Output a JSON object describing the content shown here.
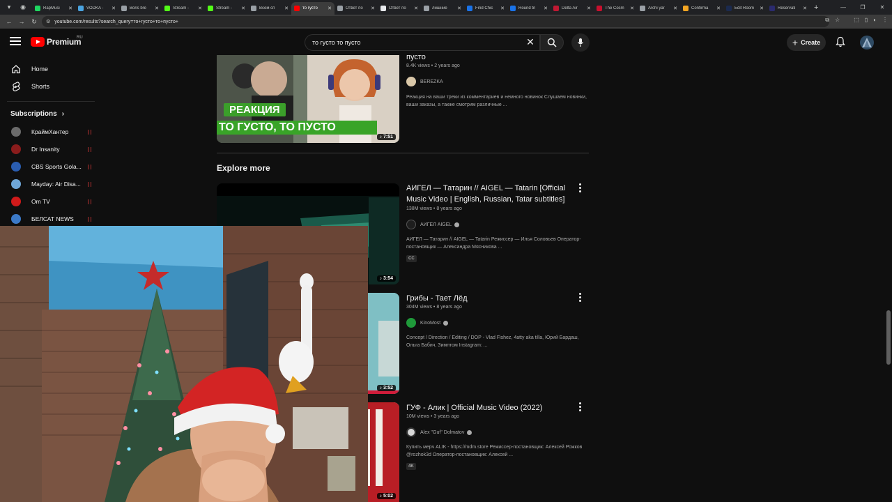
{
  "browser": {
    "tabs": [
      {
        "title": "RapMusi",
        "color": "#1ed760",
        "active": false
      },
      {
        "title": "VODKA -",
        "color": "#4aa3df",
        "active": false
      },
      {
        "title": "Boris bre",
        "color": "#9aa0a6",
        "active": false
      },
      {
        "title": "Stream - ",
        "color": "#53fc18",
        "active": false
      },
      {
        "title": "Stream - ",
        "color": "#53fc18",
        "active": false
      },
      {
        "title": "Всем сп",
        "color": "#9aa0a6",
        "active": false
      },
      {
        "title": "то густо",
        "color": "#ff0000",
        "active": true
      },
      {
        "title": "Ответ по",
        "color": "#9aa0a6",
        "active": false
      },
      {
        "title": "Ответ по",
        "color": "#e8eaed",
        "active": false
      },
      {
        "title": "лишние",
        "color": "#9aa0a6",
        "active": false
      },
      {
        "title": "Find Chic",
        "color": "#1a73e8",
        "active": false
      },
      {
        "title": "Round tri",
        "color": "#1a73e8",
        "active": false
      },
      {
        "title": "Delta Air",
        "color": "#c01933",
        "active": false
      },
      {
        "title": "The Cosm",
        "color": "#c8102e",
        "active": false
      },
      {
        "title": "Archi yar",
        "color": "#9aa0a6",
        "active": false
      },
      {
        "title": "Confirma",
        "color": "#f5a623",
        "active": false
      },
      {
        "title": "Edit Room",
        "color": "#1b2a4e",
        "active": false
      },
      {
        "title": "Reservati",
        "color": "#2b2b6e",
        "active": false
      }
    ],
    "url": "youtube.com/results?search_query=то+густо+то+пусто+"
  },
  "masthead": {
    "logo_text": "Premium",
    "region": "RU",
    "search_value": "то густо то пусто",
    "create_label": "Create"
  },
  "sidebar": {
    "items": [
      {
        "label": "Home",
        "icon": "home-icon"
      },
      {
        "label": "Shorts",
        "icon": "shorts-icon"
      }
    ],
    "subscriptions_label": "Subscriptions",
    "subscriptions": [
      {
        "name": "КраймХантер",
        "color": "#6b6b6b"
      },
      {
        "name": "Dr Insanity",
        "color": "#8a1c1c"
      },
      {
        "name": "CBS Sports Gola...",
        "color": "#2a5db0"
      },
      {
        "name": "Mayday: Air Disa...",
        "color": "#6fa7d8"
      },
      {
        "name": "Om TV",
        "color": "#d01a1a"
      },
      {
        "name": "БЕЛСАТ NEWS",
        "color": "#3c7ac8"
      }
    ]
  },
  "results": {
    "first": {
      "title_tail": "пусто",
      "views": "8.4K views",
      "age": "2 years ago",
      "channel": "BEREZKA",
      "description": "Реакция на ваши треки из комментариев и немного новинок Слушаем новинки, ваши заказы, а также смотрим различные ...",
      "duration": "7:51",
      "thumb_banner": "РЕАКЦИЯ",
      "thumb_caption": "ТО ГУСТО, ТО ПУСТО"
    },
    "explore_more": "Explore more",
    "videos": [
      {
        "title": "АИГЕЛ — Татарин // AIGEL — Tatarin [Official Music Video | English, Russian, Tatar subtitles]",
        "views": "138M views",
        "age": "8 years ago",
        "channel": "АИГЕЛ AIGEL",
        "description": "АИГЕЛ — Татарин // AIGEL — Tatarin Режиссер — Илья Соловьев Оператор-постановщик — Александра Мясникова ...",
        "badge": "CC",
        "duration": "3:54"
      },
      {
        "title": "Грибы - Тает Лёд",
        "views": "304M views",
        "age": "8 years ago",
        "channel": "KinoMost",
        "description": "Concept / Direction / Editing / DOP - Vlad Fishez, 4atty aka tilla, Юрий Бардаш, Ольга Бабич, Зимптом Instagram: ...",
        "duration": "3:52"
      },
      {
        "title": "ГУФ - Алик | Official Music Video (2022)",
        "views": "10M views",
        "age": "3 years ago",
        "channel": "Alex \"Guf\" Dolmatov",
        "description": "Купить мерч ALIK - https://mdm.store Режиссер-постановщик: Алексей Рожков @rozhok3d Оператор-постановщик: Алексей ...",
        "badge": "4K",
        "duration": "5:02"
      }
    ]
  }
}
